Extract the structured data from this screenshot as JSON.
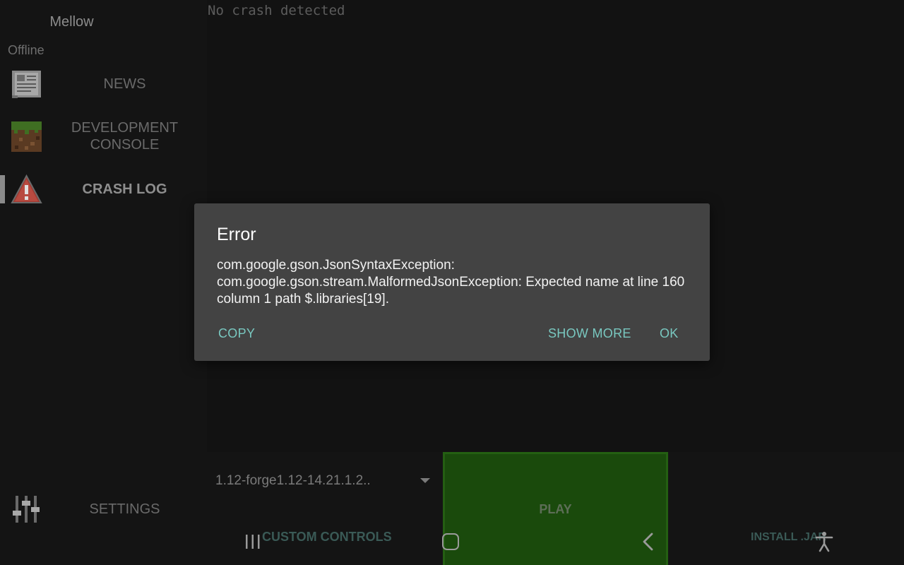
{
  "sidebar": {
    "account_name": "Mellow",
    "account_status": "Offline",
    "items": [
      {
        "label_line1": "NEWS",
        "label_line2": "",
        "icon": "news-icon"
      },
      {
        "label_line1": "DEVELOPMENT",
        "label_line2": "CONSOLE",
        "icon": "grass-block-icon"
      },
      {
        "label_line1": "CRASH LOG",
        "label_line2": "",
        "icon": "warning-icon",
        "active": true
      },
      {
        "label_line1": "SETTINGS",
        "label_line2": "",
        "icon": "sliders-icon"
      }
    ]
  },
  "console": {
    "text": "No crash detected"
  },
  "bottombar": {
    "version": "1.12-forge1.12-14.21.1.2..",
    "play_label": "PLAY",
    "custom_controls_label": "CUSTOM CONTROLS",
    "install_jar_label": "INSTALL .JAR"
  },
  "dialog": {
    "title": "Error",
    "message": "com.google.gson.JsonSyntaxException: com.google.gson.stream.MalformedJsonException: Expected name at line 160 column 1 path $.libraries[19].",
    "copy_label": "COPY",
    "show_more_label": "SHOW MORE",
    "ok_label": "OK"
  },
  "colors": {
    "accent": "#79c8c0",
    "play_green": "#1a4a0c",
    "dialog_bg": "#434343"
  }
}
